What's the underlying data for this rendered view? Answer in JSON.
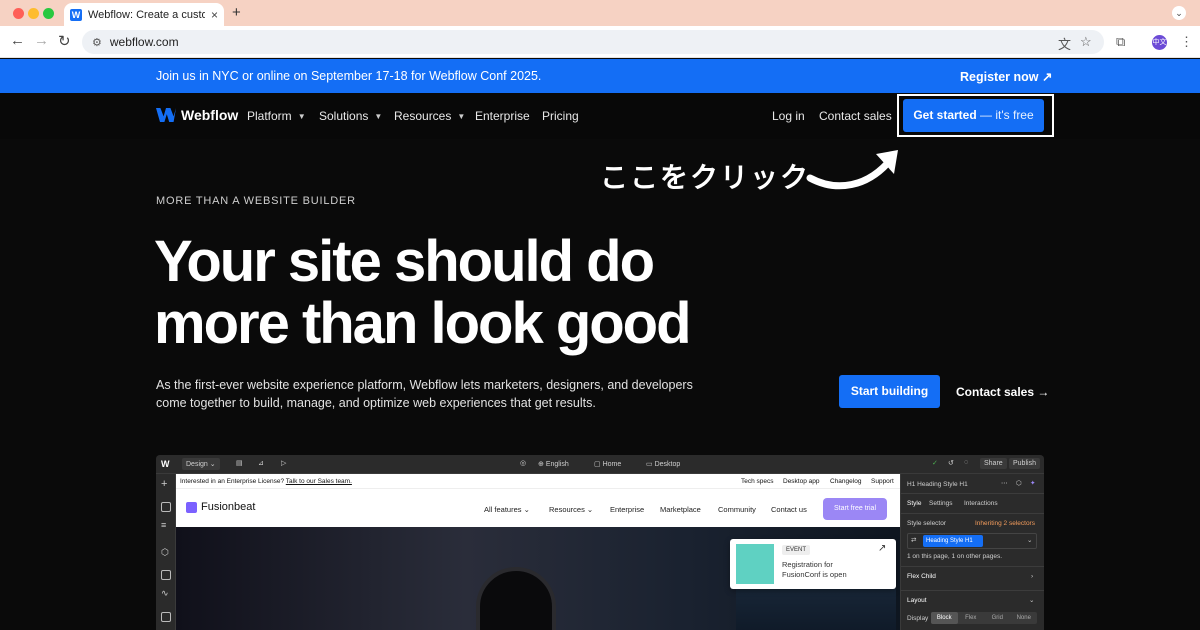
{
  "browser": {
    "tab_title": "Webflow: Create a custom we",
    "tab_close": "×",
    "new_tab": "+",
    "url": "webflow.com",
    "avatar_text": "中文"
  },
  "banner": {
    "text": "Join us in NYC or online on September 17-18 for Webflow Conf 2025.",
    "cta": "Register now ↗"
  },
  "nav": {
    "brand": "Webflow",
    "items": [
      {
        "label": "Platform",
        "dropdown": true
      },
      {
        "label": "Solutions",
        "dropdown": true
      },
      {
        "label": "Resources",
        "dropdown": true
      },
      {
        "label": "Enterprise",
        "dropdown": false
      },
      {
        "label": "Pricing",
        "dropdown": false
      }
    ],
    "login": "Log in",
    "contact": "Contact sales",
    "cta_main": "Get started",
    "cta_suffix": " — it's free"
  },
  "annotation": {
    "text": "ここをクリック"
  },
  "hero": {
    "eyebrow": "MORE THAN A WEBSITE BUILDER",
    "title_line1": "Your site should do",
    "title_line2": "more than look good",
    "description": "As the first-ever website experience platform, Webflow lets marketers, designers, and developers come together to build, manage, and optimize web experiences that get results.",
    "primary_cta": "Start building",
    "secondary_cta": "Contact sales →"
  },
  "designer": {
    "logo": "W",
    "mode": "Design ⌄",
    "locale": "English",
    "page": "Home",
    "breakpoint": "Desktop",
    "share": "Share",
    "publish": "Publish",
    "canvas": {
      "announce": "Interested in an Enterprise License?",
      "announce_link": "Talk to our Sales team.",
      "top_links": [
        "Tech specs",
        "Desktop app",
        "Changelog",
        "Support"
      ],
      "brand": "Fusionbeat",
      "nav": [
        "All features ⌄",
        "Resources ⌄",
        "Enterprise",
        "Marketplace",
        "Community",
        "Contact us"
      ],
      "trial": "Start free trial",
      "event_badge": "EVENT",
      "event_title": "Registration for FusionConf is open"
    },
    "panel": {
      "element": "Heading Style H1",
      "tabs": [
        "Style",
        "Settings",
        "Interactions"
      ],
      "selector_label": "Style selector",
      "inheriting": "Inheriting 2 selectors",
      "chip": "Heading Style H1",
      "usage": "1 on this page, 1 on other pages.",
      "flex_child": "Flex Child",
      "layout": "Layout",
      "display_label": "Display",
      "display_opts": [
        "Block",
        "Flex",
        "Grid",
        "None"
      ]
    }
  },
  "colors": {
    "brand_blue": "#146ef5",
    "background": "#080808",
    "tab_strip": "#f6d2c3"
  }
}
